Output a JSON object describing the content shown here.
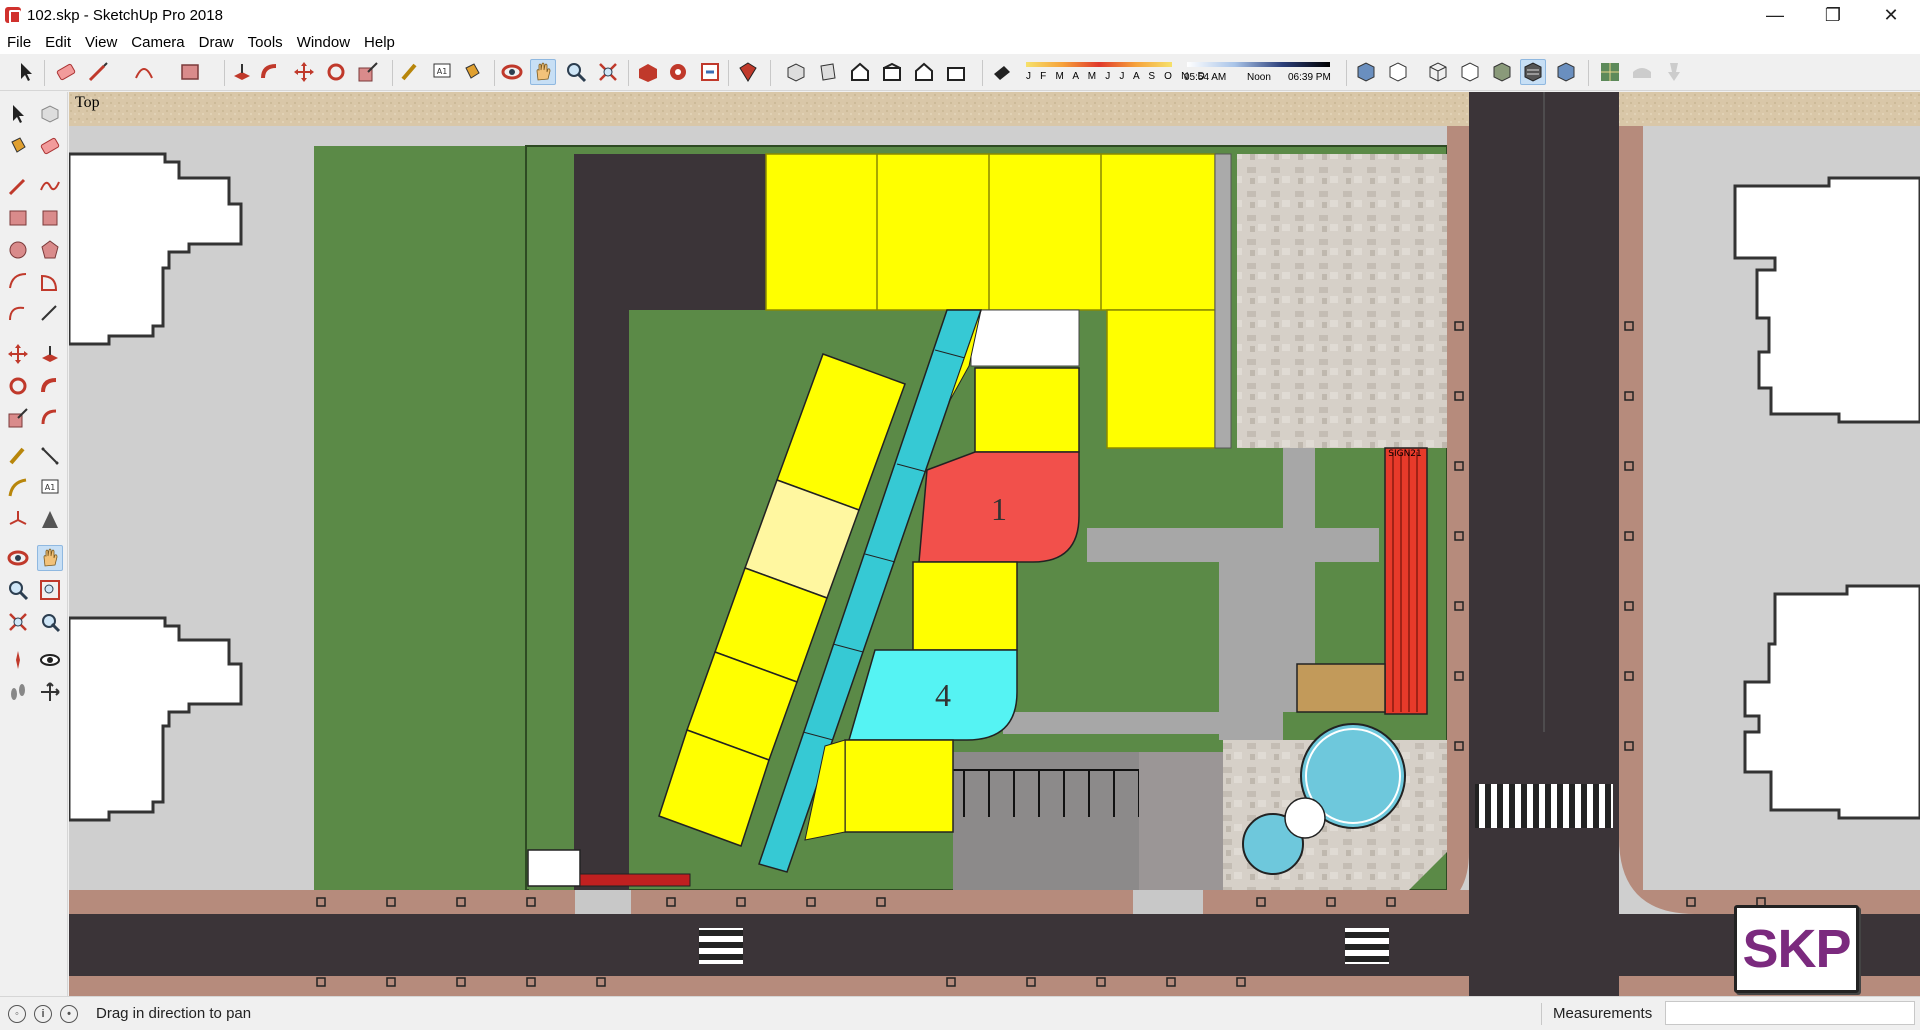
{
  "window": {
    "title": "102.skp - SketchUp Pro 2018",
    "controls": {
      "minimize": "—",
      "maximize": "❐",
      "close": "✕"
    }
  },
  "menu": [
    "File",
    "Edit",
    "View",
    "Camera",
    "Draw",
    "Tools",
    "Window",
    "Help"
  ],
  "toolbar": {
    "icons": [
      "select-icon",
      "eraser-icon",
      "line-icon",
      "arc-icon",
      "rectangle-icon",
      "push-pull-icon",
      "follow-me-icon",
      "move-icon",
      "rotate-icon",
      "scale-icon",
      "tape-measure-icon",
      "text-icon",
      "paint-bucket-icon",
      "orbit-icon",
      "pan-icon",
      "zoom-icon",
      "zoom-extents-icon",
      "3d-warehouse-icon",
      "extension-warehouse-icon",
      "layout-icon",
      "extension-manager-icon",
      "iso-view-icon",
      "top-view-icon",
      "front-view-icon",
      "right-view-icon",
      "back-view-icon",
      "left-view-icon",
      "shadows-icon",
      "xray-icon",
      "back-edges-icon",
      "wireframe-icon",
      "hidden-line-icon",
      "shaded-icon",
      "shaded-textures-icon",
      "monochrome-icon",
      "sandbox-icon",
      "drape-icon",
      "stamp-icon"
    ],
    "active_tool": "pan-icon",
    "shadow_months": "J F M A M J J A S O N D",
    "shadow_time_start": "05:54 AM",
    "shadow_time_mid": "Noon",
    "shadow_time_end": "06:39 PM"
  },
  "left_toolbar": {
    "icons": [
      "select-icon",
      "component-icon",
      "paint-bucket-icon",
      "eraser-icon",
      "line-icon",
      "freehand-icon",
      "rectangle-icon",
      "rotated-rectangle-icon",
      "circle-icon",
      "polygon-icon",
      "arc-icon",
      "pie-icon",
      "2pt-arc-icon",
      "3pt-arc-icon",
      "move-icon",
      "push-pull-icon",
      "rotate-icon",
      "follow-me-icon",
      "scale-icon",
      "offset-icon",
      "tape-measure-icon",
      "dimension-icon",
      "protractor-icon",
      "text-icon",
      "axes-icon",
      "3d-text-icon",
      "orbit-icon",
      "pan-icon",
      "zoom-icon",
      "zoom-window-icon",
      "zoom-extents-icon",
      "previous-view-icon",
      "position-camera-icon",
      "look-around-icon",
      "walk-icon",
      "section-plane-icon"
    ]
  },
  "viewport": {
    "scene_label": "Top",
    "building_labels": {
      "one": "1",
      "four": "4",
      "signage": "SIGN21"
    },
    "colors": {
      "lawn": "#5b8a47",
      "road": "#3b3438",
      "pavement": "#cfc9c4",
      "sidewalk": "#b68b7c",
      "building_yellow": "#ffff00",
      "building_pale": "#fff7a0",
      "corridor_cyan": "#36c9d4",
      "building_red": "#f2504b",
      "building_cyan": "#55f3f3",
      "pool": "#6ec8dc"
    }
  },
  "badge": {
    "text": "SKP"
  },
  "status": {
    "icons": [
      "geo-location-icon",
      "credits-icon",
      "user-icon"
    ],
    "message": "Drag in direction to pan",
    "measurements_label": "Measurements",
    "measurements_value": ""
  }
}
